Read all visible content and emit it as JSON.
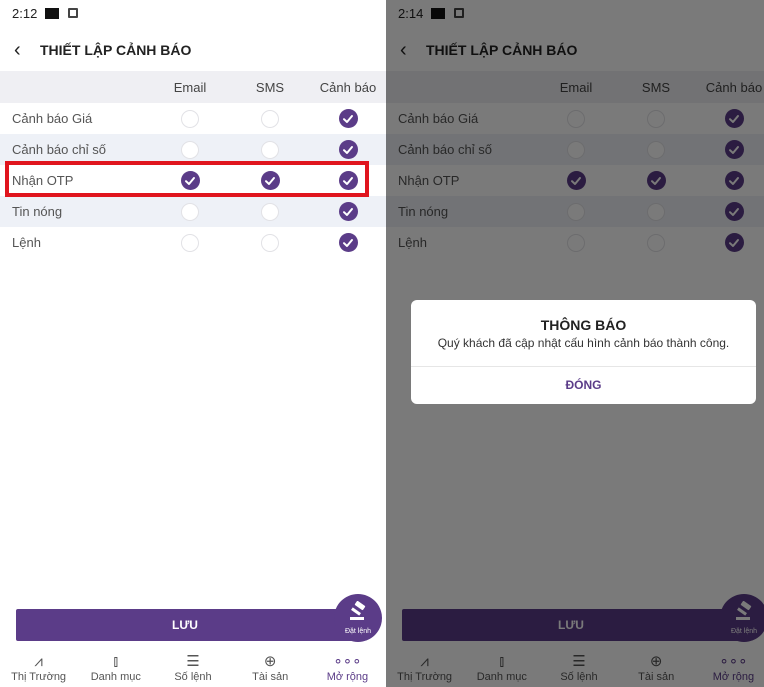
{
  "accent_color": "#5b3c88",
  "highlight_color": "#e0151e",
  "left": {
    "status_time": "2:12",
    "title": "THIẾT LẬP CẢNH BÁO",
    "columns": [
      "Email",
      "SMS",
      "Cảnh báo"
    ],
    "rows": [
      {
        "label": "Cảnh báo Giá",
        "email": false,
        "sms": false,
        "alert": true
      },
      {
        "label": "Cảnh báo chỉ số",
        "email": false,
        "sms": false,
        "alert": true
      },
      {
        "label": "Nhận OTP",
        "email": true,
        "sms": true,
        "alert": true
      },
      {
        "label": "Tin nóng",
        "email": false,
        "sms": false,
        "alert": true
      },
      {
        "label": "Lệnh",
        "email": false,
        "sms": false,
        "alert": true
      }
    ],
    "save_label": "LƯU",
    "fab_label": "Đặt lệnh",
    "nav": [
      {
        "label": "Thị Trường",
        "icon": "pulse-icon",
        "glyph": "⩘"
      },
      {
        "label": "Danh mục",
        "icon": "bar-chart-icon",
        "glyph": "⫾"
      },
      {
        "label": "Số lệnh",
        "icon": "list-icon",
        "glyph": "☰"
      },
      {
        "label": "Tài sản",
        "icon": "pie-icon",
        "glyph": "⊕"
      },
      {
        "label": "Mở rộng",
        "icon": "more-icon",
        "glyph": "∘∘∘"
      }
    ]
  },
  "right": {
    "status_time": "2:14",
    "title": "THIẾT LẬP CẢNH BÁO",
    "columns": [
      "Email",
      "SMS",
      "Cảnh báo"
    ],
    "rows": [
      {
        "label": "Cảnh báo Giá",
        "email": false,
        "sms": false,
        "alert": true
      },
      {
        "label": "Cảnh báo chỉ số",
        "email": false,
        "sms": false,
        "alert": true
      },
      {
        "label": "Nhận OTP",
        "email": true,
        "sms": true,
        "alert": true
      },
      {
        "label": "Tin nóng",
        "email": false,
        "sms": false,
        "alert": true
      },
      {
        "label": "Lệnh",
        "email": false,
        "sms": false,
        "alert": true
      }
    ],
    "save_label": "LƯU",
    "fab_label": "Đặt lệnh",
    "nav": [
      {
        "label": "Thị Trường",
        "icon": "pulse-icon",
        "glyph": "⩘"
      },
      {
        "label": "Danh mục",
        "icon": "bar-chart-icon",
        "glyph": "⫾"
      },
      {
        "label": "Số lệnh",
        "icon": "list-icon",
        "glyph": "☰"
      },
      {
        "label": "Tài sản",
        "icon": "pie-icon",
        "glyph": "⊕"
      },
      {
        "label": "Mở rộng",
        "icon": "more-icon",
        "glyph": "∘∘∘"
      }
    ],
    "dialog": {
      "title": "THÔNG BÁO",
      "message": "Quý khách đã cập nhật cấu hình cảnh báo thành công.",
      "button": "ĐÓNG"
    }
  }
}
